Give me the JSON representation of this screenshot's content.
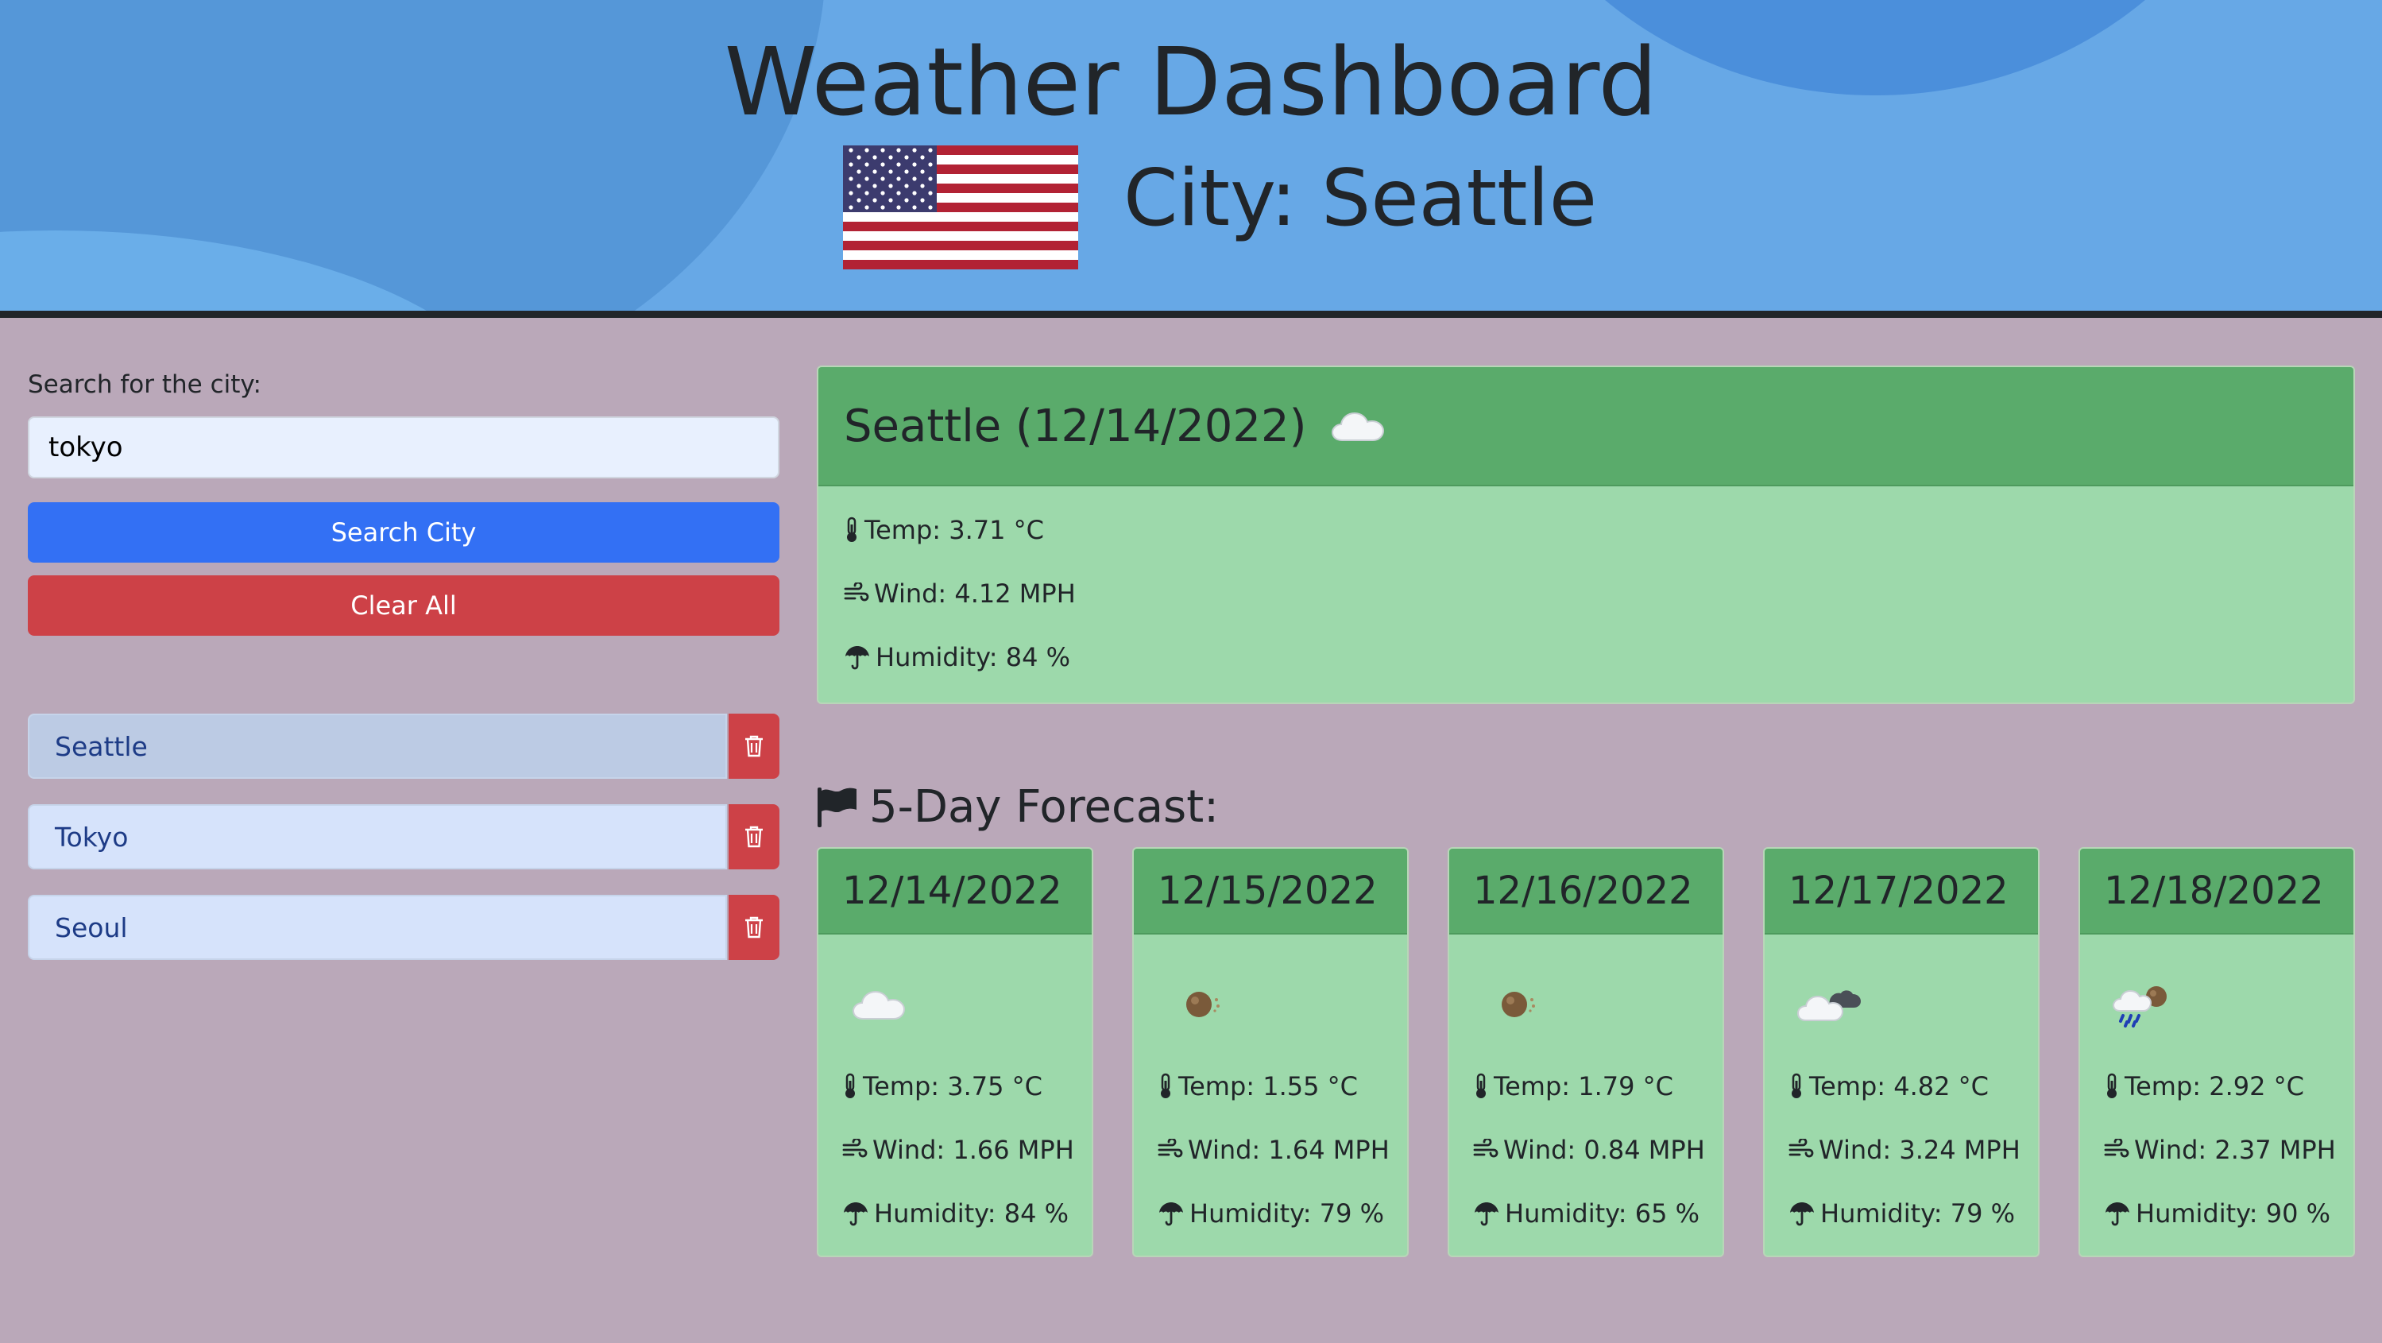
{
  "header": {
    "title": "Weather Dashboard",
    "city_heading": "City: Seattle",
    "flag_icon": "us-flag-icon"
  },
  "search": {
    "label": "Search for the city:",
    "value": "tokyo",
    "search_button": "Search City",
    "clear_button": "Clear All"
  },
  "history": [
    {
      "city": "Seattle",
      "active": true
    },
    {
      "city": "Tokyo",
      "active": false
    },
    {
      "city": "Seoul",
      "active": false
    }
  ],
  "current": {
    "title": "Seattle (12/14/2022)",
    "icon": "cloud-icon",
    "temp": "Temp: 3.71 °C",
    "wind": "Wind: 4.12 MPH",
    "humidity": "Humidity: 84 %"
  },
  "forecast": {
    "title": "5-Day Forecast:",
    "days": [
      {
        "date": "12/14/2022",
        "icon": "cloud-icon",
        "temp": "Temp: 3.75 °C",
        "wind": "Wind: 1.66 MPH",
        "humidity": "Humidity: 84 %"
      },
      {
        "date": "12/15/2022",
        "icon": "haze-icon",
        "temp": "Temp: 1.55 °C",
        "wind": "Wind: 1.64 MPH",
        "humidity": "Humidity: 79 %"
      },
      {
        "date": "12/16/2022",
        "icon": "haze-icon",
        "temp": "Temp: 1.79 °C",
        "wind": "Wind: 0.84 MPH",
        "humidity": "Humidity: 65 %"
      },
      {
        "date": "12/17/2022",
        "icon": "broken-clouds-icon",
        "temp": "Temp: 4.82 °C",
        "wind": "Wind: 3.24 MPH",
        "humidity": "Humidity: 79 %"
      },
      {
        "date": "12/18/2022",
        "icon": "rain-icon",
        "temp": "Temp: 2.92 °C",
        "wind": "Wind: 2.37 MPH",
        "humidity": "Humidity: 90 %"
      }
    ]
  },
  "colors": {
    "header_bg": "#67a8e6",
    "page_bg": "#baa8b9",
    "card_head": "#5aab6b",
    "card_body": "#9dd9ab",
    "primary": "#3370f4",
    "danger": "#cd4147"
  }
}
